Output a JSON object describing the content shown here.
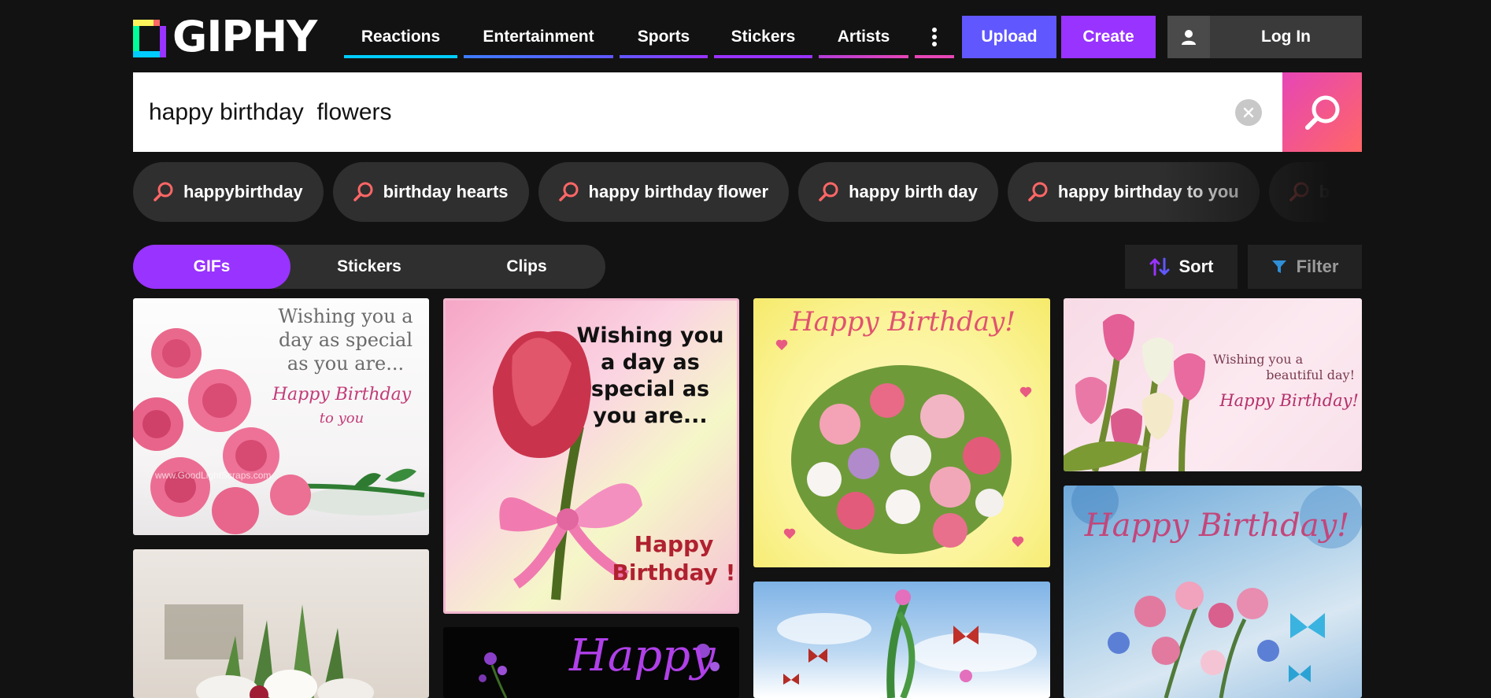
{
  "brand": {
    "name": "GIPHY"
  },
  "nav": {
    "items": [
      {
        "label": "Reactions",
        "color": "#00ccff"
      },
      {
        "label": "Entertainment",
        "color": "#6157ff"
      },
      {
        "label": "Sports",
        "color": "#9933ff"
      },
      {
        "label": "Stickers",
        "color": "#9933ff"
      },
      {
        "label": "Artists",
        "color": "#e646b6"
      }
    ],
    "more_icon": "vertical-dots-icon",
    "more_color": "#e646b6"
  },
  "header": {
    "upload_label": "Upload",
    "create_label": "Create",
    "login_label": "Log In",
    "login_icon": "user-icon"
  },
  "search": {
    "value": "happy birthday  flowers",
    "clear_icon": "clear-icon",
    "search_icon": "search-icon"
  },
  "suggestions": [
    "happybirthday",
    "birthday hearts",
    "happy birthday flower",
    "happy birth day",
    "happy birthday to you",
    "birthday"
  ],
  "tabs": [
    {
      "label": "GIFs",
      "active": true
    },
    {
      "label": "Stickers",
      "active": false
    },
    {
      "label": "Clips",
      "active": false
    }
  ],
  "sort": {
    "label": "Sort",
    "icon": "sort-arrows-icon"
  },
  "filter": {
    "label": "Filter",
    "icon": "filter-funnel-icon"
  },
  "gifs": {
    "gif1": {
      "lines": [
        "Wishing you a",
        "day as special",
        "as you are..."
      ],
      "script": [
        "Happy Birthday",
        "to you"
      ],
      "watermark": "www.GoodLightScraps.com"
    },
    "gif2": {
      "lines": [
        "Wishing you",
        "a day as",
        "special as",
        "you are..."
      ],
      "script": [
        "Happy",
        "Birthday !"
      ]
    },
    "gif3": {
      "script": "Happy Birthday!"
    },
    "gif4": {
      "lines": [
        "Wishing you a",
        "beautiful day!"
      ],
      "script": "Happy Birthday!"
    },
    "gif6": {
      "script": "Happy"
    },
    "gif8": {
      "script": "Happy Birthday!"
    }
  },
  "colors": {
    "accent_purple": "#9933ff",
    "accent_blue": "#6157ff",
    "accent_pink": "#e646b6",
    "background": "#121212"
  }
}
